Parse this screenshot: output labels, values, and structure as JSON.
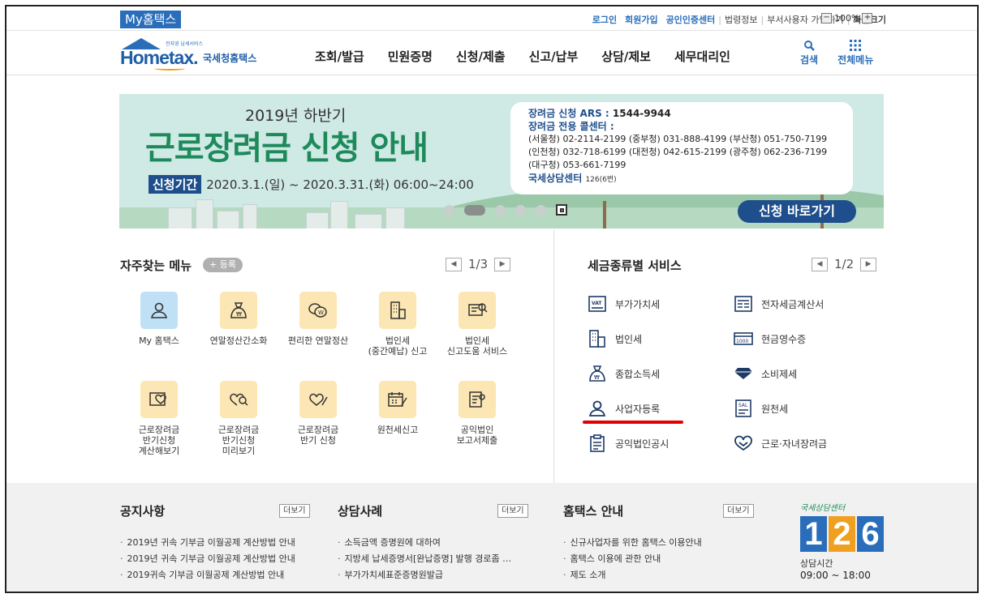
{
  "topbar": {
    "brand": "My홈택스",
    "links": [
      "로그인",
      "회원가입",
      "공인인증센터"
    ],
    "gray_links": [
      "법령정보",
      "부서사용자 가입하기",
      "화면크기"
    ],
    "zoom_minus": "−",
    "zoom": "100%",
    "zoom_plus": "+"
  },
  "header": {
    "logo_word": "Hometax.",
    "logo_sub": "국세청홈택스",
    "logo_tiny": "전자영 납세서비스",
    "nav": [
      "조회/발급",
      "민원증명",
      "신청/제출",
      "신고/납부",
      "상담/제보",
      "세무대리인"
    ],
    "search": "검색",
    "all_menu": "전체메뉴"
  },
  "banner": {
    "subtitle": "2019년 하반기",
    "title": "근로장려금 신청 안내",
    "period_tag": "신청기간",
    "period": "2020.3.1.(일) ~ 2020.3.31.(화) 06:00~24:00",
    "ars_label": "장려금 신청 ARS :",
    "ars_number": "1544-9944",
    "call_center": "장려금 전용 콜센터 :",
    "rows": [
      "(서울청) 02-2114-2199 (중부청) 031-888-4199 (부산청) 051-750-7199",
      "(인천청) 032-718-6199 (대전청) 042-615-2199 (광주청) 062-236-7199",
      "(대구청) 053-661-7199"
    ],
    "center_label": "국세상담센터",
    "center_num": "126(6번)",
    "cta": "신청 바로가기"
  },
  "favorites": {
    "title": "자주찾는 메뉴",
    "register": "+ 등록",
    "page": "1/3",
    "items": [
      {
        "label": "My 홈택스",
        "icon": "person-icon"
      },
      {
        "label": "연말정산간소화",
        "icon": "money-bag-icon"
      },
      {
        "label": "편리한 연말정산",
        "icon": "coins-icon"
      },
      {
        "label": "법인세\n(중간예납) 신고",
        "icon": "building-icon"
      },
      {
        "label": "법인세\n신고도움 서비스",
        "icon": "document-search-icon"
      },
      {
        "label": "근로장려금\n반기신청\n계산해보기",
        "icon": "heart-card-icon"
      },
      {
        "label": "근로장려금\n반기신청\n미리보기",
        "icon": "heart-search-icon"
      },
      {
        "label": "근로장려금\n반기 신청",
        "icon": "heart-pen-icon"
      },
      {
        "label": "원천세신고",
        "icon": "calendar-pen-icon"
      },
      {
        "label": "공익법인\n보고서제출",
        "icon": "report-icon"
      }
    ]
  },
  "tax_services": {
    "title": "세금종류별 서비스",
    "page": "1/2",
    "left": [
      {
        "label": "부가가치세",
        "icon": "vat-icon"
      },
      {
        "label": "법인세",
        "icon": "building-icon"
      },
      {
        "label": "종합소득세",
        "icon": "money-bag-icon"
      },
      {
        "label": "사업자등록",
        "icon": "person-icon"
      },
      {
        "label": "공익법인공시",
        "icon": "clipboard-icon"
      }
    ],
    "right": [
      {
        "label": "전자세금계산서",
        "icon": "invoice-icon"
      },
      {
        "label": "현금영수증",
        "icon": "receipt-icon"
      },
      {
        "label": "소비제세",
        "icon": "diamond-icon"
      },
      {
        "label": "원천세",
        "icon": "salary-icon"
      },
      {
        "label": "근로·자녀장려금",
        "icon": "heart-hand-icon"
      }
    ],
    "highlight_color": "#e30000"
  },
  "footer": {
    "notices": {
      "title": "공지사항",
      "more": "더보기",
      "items": [
        "2019년 귀속 기부금 이월공제 계산방법 안내",
        "2019년 귀속 기부금 이월공제 계산방법 안내",
        "2019귀속 기부금 이월공제 계산방법 안내"
      ]
    },
    "cases": {
      "title": "상담사례",
      "more": "더보기",
      "items": [
        "소득금액 증명원에 대하여",
        "지방세 납세증명서[완납증명] 발행 경로좀 …",
        "부가가치세표준증명원발급"
      ]
    },
    "guide": {
      "title": "홈택스 안내",
      "more": "더보기",
      "items": [
        "신규사업자를 위한 홈택스 이용안내",
        "홈택스 이용에 관한 안내",
        "제도 소개"
      ]
    },
    "center": {
      "hand": "국세상담센터",
      "digits": [
        "1",
        "2",
        "6"
      ],
      "hours_label": "상담시간",
      "hours": "09:00 ~ 18:00"
    }
  },
  "colors": {
    "brand_blue": "#2a6ebb",
    "banner_green": "#1e8a5c",
    "navy": "#1e4f8c"
  }
}
